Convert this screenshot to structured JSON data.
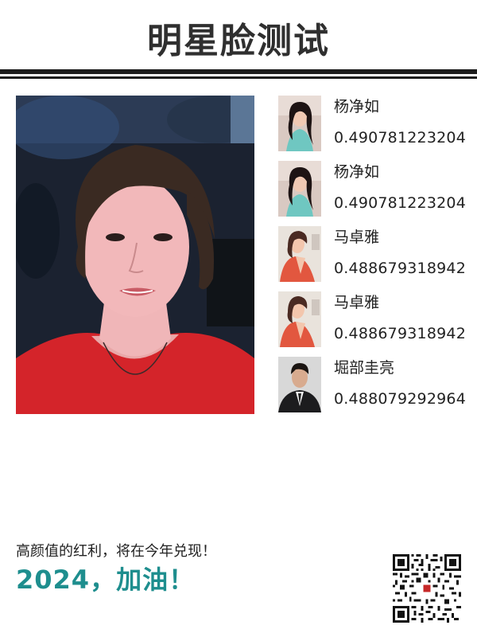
{
  "header": {
    "title": "明星脸测试"
  },
  "main_photo": {
    "description": "uploaded face photo"
  },
  "matches": [
    {
      "name": "杨净如",
      "score": "0.490781223204",
      "thumb_style": "teal-dress"
    },
    {
      "name": "杨净如",
      "score": "0.490781223204",
      "thumb_style": "teal-dress"
    },
    {
      "name": "马卓雅",
      "score": "0.488679318942",
      "thumb_style": "red-top"
    },
    {
      "name": "马卓雅",
      "score": "0.488679318942",
      "thumb_style": "red-top"
    },
    {
      "name": "堀部圭亮",
      "score": "0.488079292964",
      "thumb_style": "dark-suit"
    }
  ],
  "footer": {
    "slogan": "高颜值的红利，将在今年兑现！",
    "cheer": "2024，加油！"
  },
  "colors": {
    "title": "#2f2f2f",
    "rule": "#1d1d1d",
    "cheer": "#1e8e8e"
  },
  "icons": {
    "qr": "qr-code-icon"
  }
}
